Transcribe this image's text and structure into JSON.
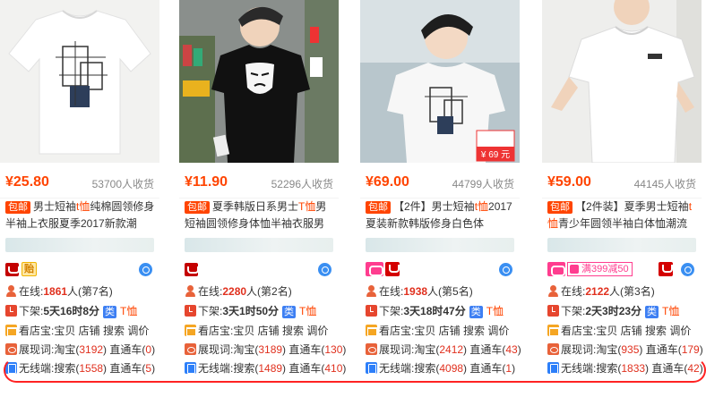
{
  "items": [
    {
      "price": "¥25.80",
      "sold": "53700人收货",
      "mail_tag": "包邮",
      "title_a": "男士短袖",
      "title_hl": "t恤",
      "title_b": "纯棉圆领修身半袖上衣服夏季2017新款潮",
      "badge_gold": "贻",
      "online_label": "在线:",
      "online_num": "1861",
      "online_rank": "人(第7名)",
      "down_label": "下架:",
      "down_value": "5天16时8分",
      "cat": "类",
      "cat_value": "T恤",
      "shop_links": "看店宝:宝贝 店铺 搜索 调价",
      "show_label": "展现词:",
      "show_a": "淘宝(",
      "show_a_num": "3192",
      "show_b": ") 直通车(",
      "show_b_num": "0",
      "show_end": ")",
      "wireless_label": "无线端:",
      "wl_a": "搜索(",
      "wl_a_num": "1558",
      "wl_b": ") 直通车(",
      "wl_b_num": "5",
      "wl_end": ")"
    },
    {
      "price": "¥11.90",
      "sold": "52296人收货",
      "mail_tag": "包邮",
      "title_a": "夏季韩版日系男士",
      "title_hl": "T恤",
      "title_b": "男短袖圆领修身体恤半袖衣服男",
      "online_label": "在线:",
      "online_num": "2280",
      "online_rank": "人(第2名)",
      "down_label": "下架:",
      "down_value": "3天1时50分",
      "cat": "类",
      "cat_value": "T恤",
      "shop_links": "看店宝:宝贝 店铺 搜索 调价",
      "show_label": "展现词:",
      "show_a": "淘宝(",
      "show_a_num": "3189",
      "show_b": ") 直通车(",
      "show_b_num": "130",
      "show_end": ")",
      "wireless_label": "无线端:",
      "wl_a": "搜索(",
      "wl_a_num": "1489",
      "wl_b": ") 直通车(",
      "wl_b_num": "410",
      "wl_end": ")"
    },
    {
      "price": "¥69.00",
      "sold": "44799人收货",
      "mail_tag": "包邮",
      "title_a": "【2件】男士短袖",
      "title_hl": "t恤",
      "title_b": "2017夏装新款韩版修身白色体",
      "sticker_price": "¥ 69 元",
      "online_label": "在线:",
      "online_num": "1938",
      "online_rank": "人(第5名)",
      "down_label": "下架:",
      "down_value": "3天18时47分",
      "cat": "类",
      "cat_value": "T恤",
      "shop_links": "看店宝:宝贝 店铺 搜索 调价",
      "show_label": "展现词:",
      "show_a": "淘宝(",
      "show_a_num": "2412",
      "show_b": ") 直通车(",
      "show_b_num": "43",
      "show_end": ")",
      "wireless_label": "无线端:",
      "wl_a": "搜索(",
      "wl_a_num": "4098",
      "wl_b": ") 直通车(",
      "wl_b_num": "1",
      "wl_end": ")"
    },
    {
      "price": "¥59.00",
      "sold": "44145人收货",
      "mail_tag": "包邮",
      "title_a": "【2件装】夏季男士短袖",
      "title_hl": "t恤",
      "title_b": "青少年圆领半袖白体恤潮流",
      "promo": "满399减50",
      "online_label": "在线:",
      "online_num": "2122",
      "online_rank": "人(第3名)",
      "down_label": "下架:",
      "down_value": "2天3时23分",
      "cat": "类",
      "cat_value": "T恤",
      "shop_links": "看店宝:宝贝 店铺 搜索 调价",
      "show_label": "展现词:",
      "show_a": "淘宝(",
      "show_a_num": "935",
      "show_b": ") 直通车(",
      "show_b_num": "179",
      "show_end": ")",
      "wireless_label": "无线端:",
      "wl_a": "搜索(",
      "wl_a_num": "1833",
      "wl_b": ") 直通车(",
      "wl_b_num": "42",
      "wl_end": ")"
    }
  ],
  "colors": {
    "price": "#ff4400",
    "highlight": "#ff2222",
    "number": "#e0301e",
    "link_blue": "#2d66c2"
  }
}
